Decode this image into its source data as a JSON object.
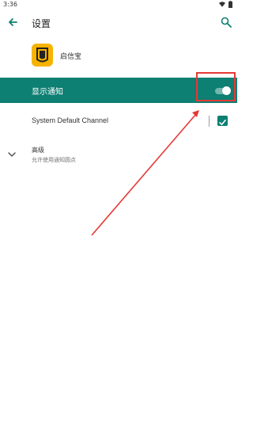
{
  "status_bar": {
    "time": "3:36",
    "icons": [
      "wifi-icon",
      "battery-icon"
    ]
  },
  "app_bar": {
    "title": "设置",
    "back_icon": "arrow-back-icon",
    "search_icon": "search-icon"
  },
  "app": {
    "name": "启信宝",
    "icon": "app-logo-icon"
  },
  "notification": {
    "label": "显示通知",
    "enabled": true
  },
  "channel": {
    "label": "System Default Channel",
    "checked": true
  },
  "advanced": {
    "title": "高级",
    "subtitle": "允许使用通知圆点"
  },
  "colors": {
    "accent": "#0d7f73",
    "annotation": "#e53935",
    "app_icon_bg": "#f6b400"
  }
}
